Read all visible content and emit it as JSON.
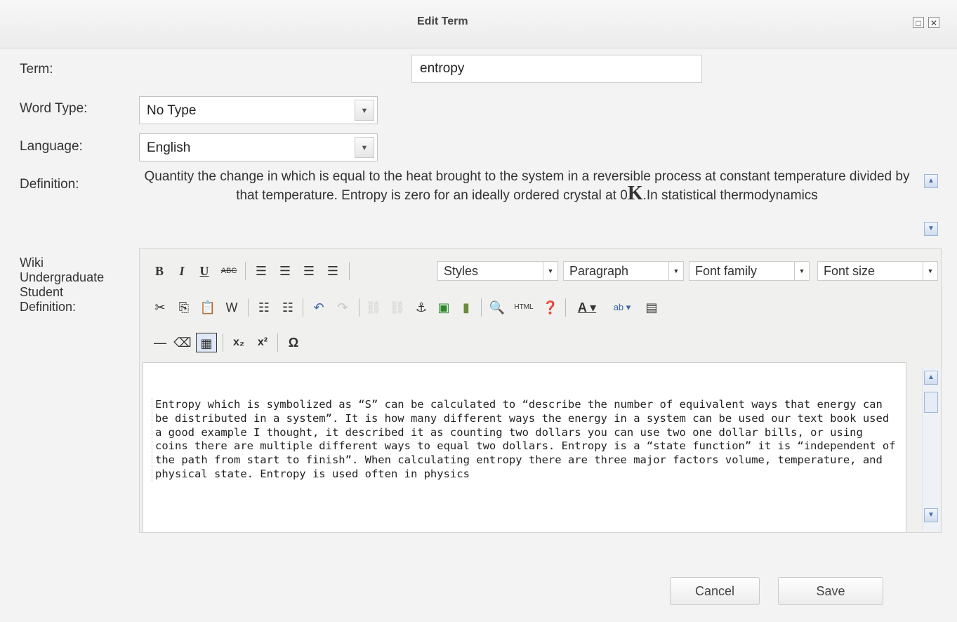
{
  "dialog": {
    "title": "Edit Term"
  },
  "form": {
    "term_label": "Term:",
    "term_value": "entropy",
    "word_type_label": "Word Type:",
    "word_type_value": "No Type",
    "language_label": "Language:",
    "language_value": "English",
    "definition_label": "Definition:",
    "definition_text_part1": "Quantity the change in which is equal to the heat brought to the system in a reversible process at constant temperature divided by that temperature. Entropy is zero for an ideally ordered crystal at 0",
    "definition_k": "K",
    "definition_text_part2": ".In statistical thermodynamics",
    "wiki_label_line1": "Wiki",
    "wiki_label_line2": "Undergraduate",
    "wiki_label_line3": "Student",
    "wiki_label_line4": "Definition:"
  },
  "toolbar": {
    "bold": "B",
    "italic": "I",
    "underline": "U",
    "strike": "ABC",
    "styles": "Styles",
    "paragraph": "Paragraph",
    "font_family": "Font family",
    "font_size": "Font size",
    "html": "HTML"
  },
  "editor": {
    "content": "Entropy which is symbolized as “S” can be calculated to “describe the number of equivalent ways that energy can be distributed in a system”. It is how many different ways the energy in a system can be used our text book used a good example I thought, it described it as counting two dollars you can use two one dollar bills, or using coins there are multiple different ways to equal two dollars. Entropy is a “state function” it is “independent of the path from start to finish”. When calculating entropy there are three major factors volume, temperature, and physical state. Entropy is used often in physics"
  },
  "buttons": {
    "cancel": "Cancel",
    "save": "Save"
  },
  "colors": {
    "accent": "#4a6ea8",
    "text": "#333333"
  }
}
